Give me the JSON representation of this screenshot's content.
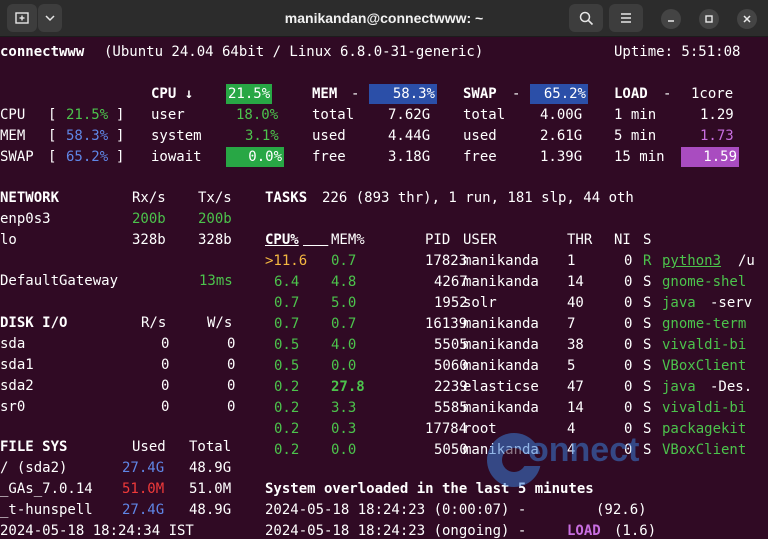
{
  "window": {
    "title": "manikandan@connectwww: ~"
  },
  "header": {
    "hostname": "connectwww",
    "sysinfo": "(Ubuntu 24.04 64bit / Linux 6.8.0-31-generic)",
    "uptime": "Uptime: 5:51:08"
  },
  "quicklook": {
    "cpu": {
      "label": "CPU",
      "value": "21.5%"
    },
    "mem": {
      "label": "MEM",
      "value": "58.3%"
    },
    "swap": {
      "label": "SWAP",
      "value": "65.2%"
    }
  },
  "cpu": {
    "title": "CPU ↓",
    "total": "21.5%",
    "rows": [
      {
        "label": "user",
        "value": "18.0%"
      },
      {
        "label": "system",
        "value": "3.1%"
      },
      {
        "label": "iowait",
        "value": "0.0%"
      }
    ]
  },
  "mem": {
    "title": "MEM",
    "dash": "-",
    "total": "58.3%",
    "rows": [
      {
        "label": "total",
        "value": "7.62G"
      },
      {
        "label": "used",
        "value": "4.44G"
      },
      {
        "label": "free",
        "value": "3.18G"
      }
    ]
  },
  "swap": {
    "title": "SWAP",
    "dash": "-",
    "total": "65.2%",
    "rows": [
      {
        "label": "total",
        "value": "4.00G"
      },
      {
        "label": "used",
        "value": "2.61G"
      },
      {
        "label": "free",
        "value": "1.39G"
      }
    ]
  },
  "load": {
    "title": "LOAD",
    "dash": "-",
    "cores": "1core",
    "rows": [
      {
        "label": "1 min",
        "value": "1.29"
      },
      {
        "label": "5 min",
        "value": "1.73"
      },
      {
        "label": "15 min",
        "value": "1.59"
      }
    ]
  },
  "network": {
    "title": "NETWORK",
    "rx": "Rx/s",
    "tx": "Tx/s",
    "rows": [
      {
        "name": "enp0s3",
        "rx": "200b",
        "tx": "200b"
      },
      {
        "name": "lo",
        "rx": "328b",
        "tx": "328b"
      }
    ],
    "gateway": {
      "name": "DefaultGateway",
      "value": "13ms"
    }
  },
  "disk": {
    "title": "DISK I/O",
    "r": "R/s",
    "w": "W/s",
    "rows": [
      {
        "name": "sda",
        "r": "0",
        "w": "0"
      },
      {
        "name": "sda1",
        "r": "0",
        "w": "0"
      },
      {
        "name": "sda2",
        "r": "0",
        "w": "0"
      },
      {
        "name": "sr0",
        "r": "0",
        "w": "0"
      }
    ]
  },
  "fs": {
    "title": "FILE SYS",
    "used": "Used",
    "total": "Total",
    "rows": [
      {
        "name": "/ (sda2)",
        "used": "27.4G",
        "total": "48.9G",
        "color": "blue"
      },
      {
        "name": "_GAs_7.0.14",
        "used": "51.0M",
        "total": "51.0M",
        "color": "red"
      },
      {
        "name": "_t-hunspell",
        "used": "27.4G",
        "total": "48.9G",
        "color": "blue"
      }
    ]
  },
  "tasks": {
    "title": "TASKS",
    "summary": "226 (893 thr), 1 run, 181 slp, 44 oth"
  },
  "processes": {
    "headers": {
      "cpu": "CPU%",
      "mem": "MEM%",
      "pid": "PID",
      "user": "USER",
      "thr": "THR",
      "ni": "NI",
      "s": "S"
    },
    "rows": [
      {
        "cpu": ">11.6",
        "mem": "0.7",
        "pid": "17823",
        "user": "manikanda",
        "thr": "1",
        "ni": "0",
        "s": "R",
        "cmd": "python3",
        "args": "/u"
      },
      {
        "cpu": "6.4",
        "mem": "4.8",
        "pid": "4267",
        "user": "manikanda",
        "thr": "14",
        "ni": "0",
        "s": "S",
        "cmd": "gnome-shel",
        "args": ""
      },
      {
        "cpu": "0.7",
        "mem": "5.0",
        "pid": "1952",
        "user": "solr",
        "thr": "40",
        "ni": "0",
        "s": "S",
        "cmd": "java",
        "args": "-serv"
      },
      {
        "cpu": "0.7",
        "mem": "0.7",
        "pid": "16139",
        "user": "manikanda",
        "thr": "7",
        "ni": "0",
        "s": "S",
        "cmd": "gnome-term",
        "args": ""
      },
      {
        "cpu": "0.5",
        "mem": "4.0",
        "pid": "5505",
        "user": "manikanda",
        "thr": "38",
        "ni": "0",
        "s": "S",
        "cmd": "vivaldi-bi",
        "args": ""
      },
      {
        "cpu": "0.5",
        "mem": "0.0",
        "pid": "5060",
        "user": "manikanda",
        "thr": "5",
        "ni": "0",
        "s": "S",
        "cmd": "VBoxClient",
        "args": ""
      },
      {
        "cpu": "0.2",
        "mem": "27.8",
        "pid": "2239",
        "user": "elasticse",
        "thr": "47",
        "ni": "0",
        "s": "S",
        "cmd": "java",
        "args": "-Des."
      },
      {
        "cpu": "0.2",
        "mem": "3.3",
        "pid": "5585",
        "user": "manikanda",
        "thr": "14",
        "ni": "0",
        "s": "S",
        "cmd": "vivaldi-bi",
        "args": ""
      },
      {
        "cpu": "0.2",
        "mem": "0.3",
        "pid": "17784",
        "user": "root",
        "thr": "4",
        "ni": "0",
        "s": "S",
        "cmd": "packagekit",
        "args": ""
      },
      {
        "cpu": "0.2",
        "mem": "0.0",
        "pid": "5050",
        "user": "manikanda",
        "thr": "4",
        "ni": "0",
        "s": "S",
        "cmd": "VBoxClient",
        "args": ""
      }
    ]
  },
  "alerts": {
    "title": "System overloaded in the last 5 minutes",
    "rows": [
      {
        "time": "2024-05-18 18:24:23 (0:00:07) -",
        "label": "",
        "value": "(92.6)"
      },
      {
        "time": "2024-05-18 18:24:23 (ongoing) -",
        "label": "LOAD",
        "value": "(1.6)"
      }
    ]
  },
  "clock": "2024-05-18 18:24:34 IST",
  "watermark": {
    "text": "onnect"
  },
  "colors": {
    "terminal_bg": "#300a24",
    "green": "#4cc34c",
    "blue": "#5f86e6",
    "red": "#ef3a3a",
    "magenta": "#c86ee0"
  }
}
